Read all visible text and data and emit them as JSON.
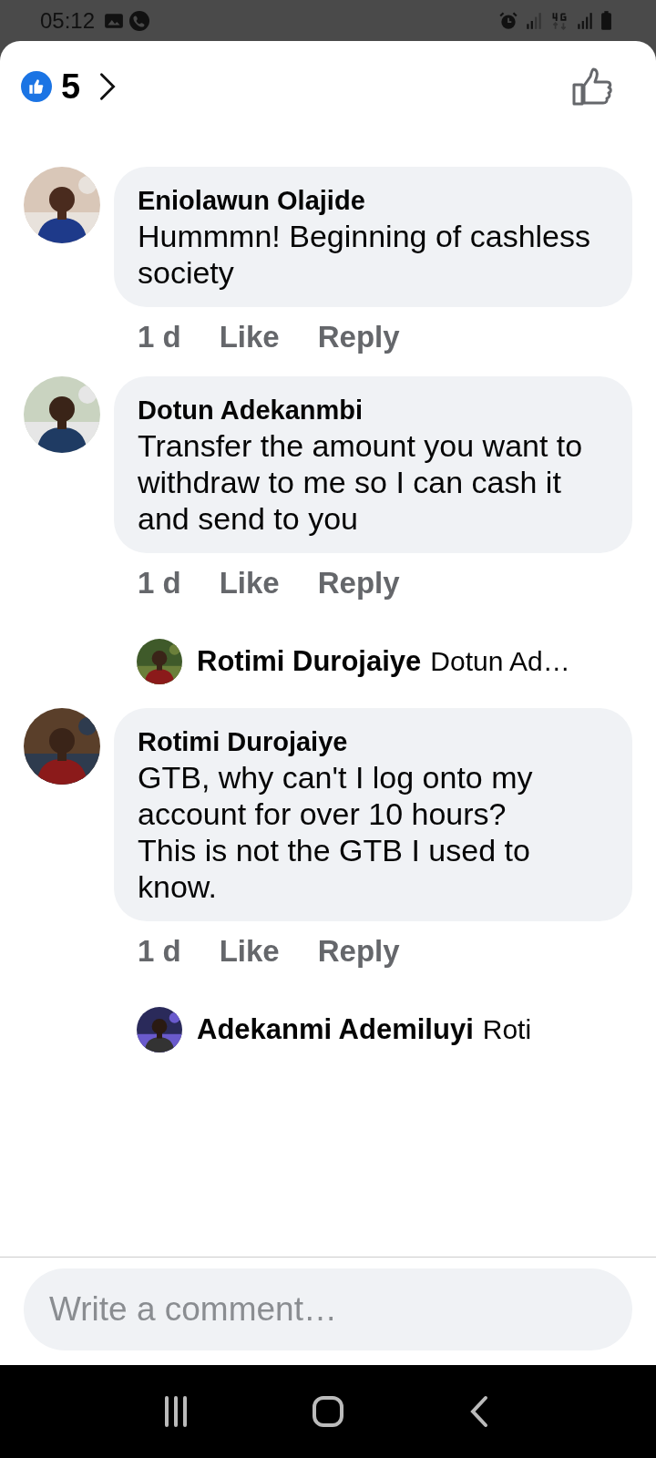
{
  "status_bar": {
    "time": "05:12"
  },
  "header": {
    "reaction_count": "5"
  },
  "items": [
    {
      "kind": "comment",
      "author": "Eniolawun Olajide",
      "text": "Hummmn! Beginning of cashless society",
      "time": "1 d",
      "actions": [
        "Like",
        "Reply"
      ]
    },
    {
      "kind": "comment",
      "author": "Dotun Adekanmbi",
      "text": "Transfer the amount you want to withdraw to me so I can cash it and send to you",
      "time": "1 d",
      "actions": [
        "Like",
        "Reply"
      ]
    },
    {
      "kind": "reply_preview",
      "author": "Rotimi Durojaiye",
      "text": "Dotun Ad…"
    },
    {
      "kind": "comment",
      "author": "Rotimi Durojaiye",
      "text": "GTB, why can't I log onto my account for over 10 hours?\nThis is not the GTB I used to know.",
      "time": "1 d",
      "actions": [
        "Like",
        "Reply"
      ]
    },
    {
      "kind": "reply_preview",
      "author": "Adekanmi Ademiluyi",
      "text": "Roti"
    }
  ],
  "composer": {
    "placeholder": "Write a comment…"
  }
}
